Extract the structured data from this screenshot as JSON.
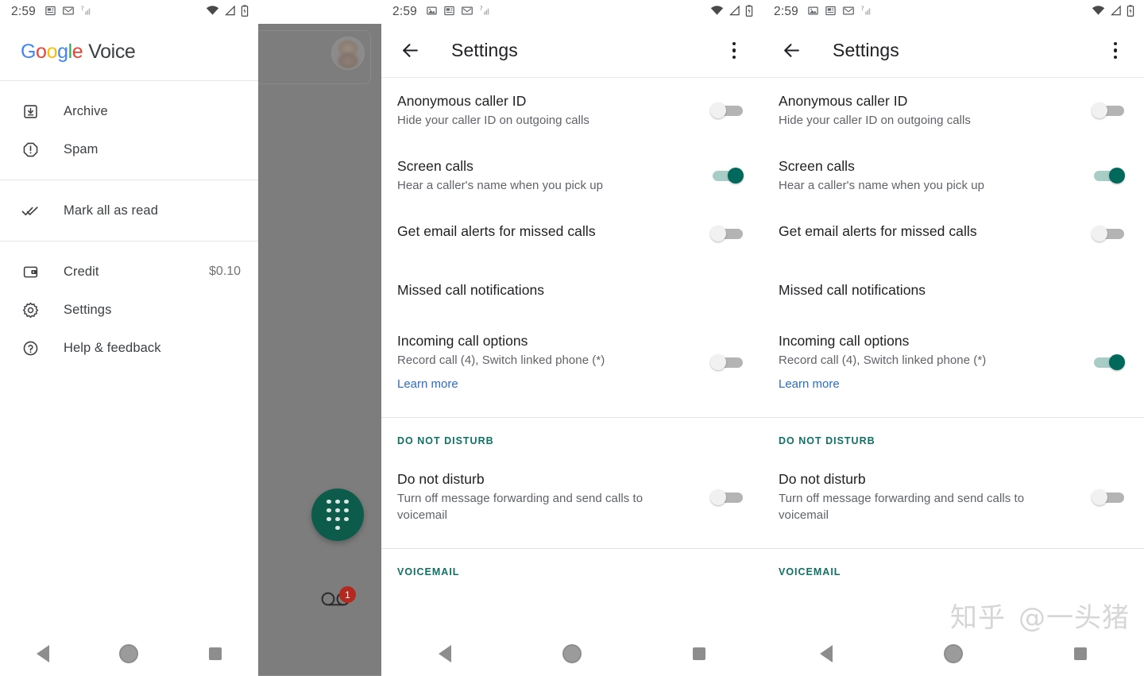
{
  "statusbar": {
    "time": "2:59",
    "left_icons_p1": [
      "news-icon",
      "gmail-icon",
      "signal-unknown-icon"
    ],
    "left_icons_p3": [
      "image-icon",
      "news-icon",
      "gmail-icon",
      "signal-unknown-icon"
    ],
    "left_icons_p4": [
      "image-icon",
      "news-icon",
      "gmail-icon",
      "signal-unknown-icon"
    ],
    "right_icons": [
      "wifi-icon",
      "cell-signal-icon",
      "battery-icon"
    ]
  },
  "drawer": {
    "logo": {
      "g": "G",
      "o1": "o",
      "o2": "o",
      "g2": "g",
      "l": "l",
      "e": "e",
      "product": "Voice"
    },
    "groups": [
      {
        "items": [
          {
            "icon": "archive-icon",
            "label": "Archive"
          },
          {
            "icon": "spam-icon",
            "label": "Spam"
          }
        ]
      },
      {
        "items": [
          {
            "icon": "double-check-icon",
            "label": "Mark all as read"
          }
        ]
      },
      {
        "items": [
          {
            "icon": "wallet-icon",
            "label": "Credit",
            "value": "$0.10"
          },
          {
            "icon": "gear-icon",
            "label": "Settings"
          },
          {
            "icon": "help-icon",
            "label": "Help & feedback"
          }
        ]
      }
    ]
  },
  "scrim_panel": {
    "fab": "dialpad-fab",
    "voicemail_icon": "voicemail-icon",
    "voicemail_badge": "1"
  },
  "appbar": {
    "back": "back-arrow-icon",
    "title": "Settings",
    "overflow": "overflow-menu-icon"
  },
  "settings_panel_a": {
    "rows": [
      {
        "title": "Anonymous caller ID",
        "sub": "Hide your caller ID on outgoing calls",
        "toggle": "off"
      },
      {
        "title": "Screen calls",
        "sub": "Hear a caller's name when you pick up",
        "toggle": "on"
      },
      {
        "title": "Get email alerts for missed calls",
        "sub": "",
        "toggle": "off"
      },
      {
        "title": "Missed call notifications",
        "sub": "",
        "toggle": "none"
      },
      {
        "title": "Incoming call options",
        "sub": "Record call (4), Switch linked phone (*)",
        "link": "Learn more",
        "toggle": "off"
      }
    ],
    "dnd_header": "DO NOT DISTURB",
    "dnd_row": {
      "title": "Do not disturb",
      "sub": "Turn off message forwarding and send calls to voicemail",
      "toggle": "off"
    },
    "voicemail_header": "VOICEMAIL"
  },
  "settings_panel_b": {
    "rows": [
      {
        "title": "Anonymous caller ID",
        "sub": "Hide your caller ID on outgoing calls",
        "toggle": "off"
      },
      {
        "title": "Screen calls",
        "sub": "Hear a caller's name when you pick up",
        "toggle": "on"
      },
      {
        "title": "Get email alerts for missed calls",
        "sub": "",
        "toggle": "off"
      },
      {
        "title": "Missed call notifications",
        "sub": "",
        "toggle": "none"
      },
      {
        "title": "Incoming call options",
        "sub": "Record call (4), Switch linked phone (*)",
        "link": "Learn more",
        "toggle": "on"
      }
    ],
    "dnd_header": "DO NOT DISTURB",
    "dnd_row": {
      "title": "Do not disturb",
      "sub": "Turn off message forwarding and send calls to voicemail",
      "toggle": "off"
    },
    "voicemail_header": "VOICEMAIL"
  },
  "navbar": {
    "back": "back-triangle-icon",
    "home": "home-circle-icon",
    "recents": "recents-square-icon"
  },
  "watermark": {
    "site": "知乎",
    "handle": "@一头猪"
  },
  "colors": {
    "accent_green": "#00695c",
    "section_header": "#0f7165",
    "link_blue": "#2b6cc4",
    "fab_green": "#0d5c4b",
    "badge_red": "#b3291f"
  }
}
